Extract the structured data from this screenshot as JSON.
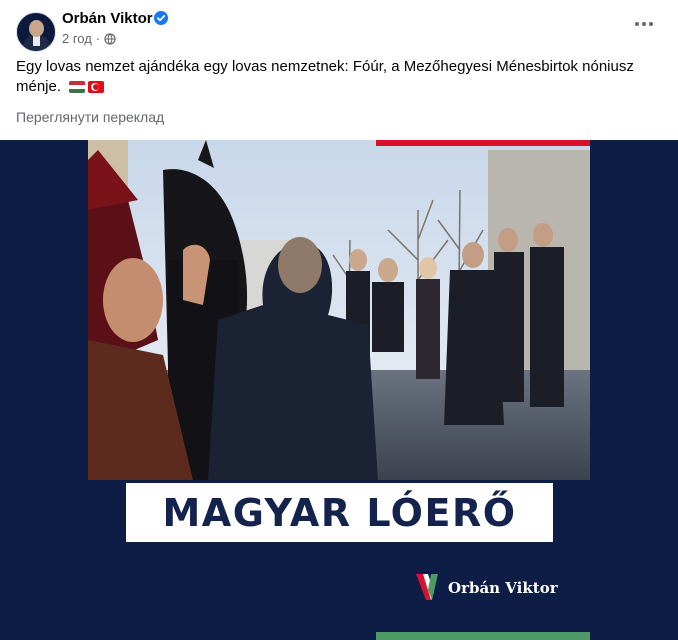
{
  "post": {
    "author_name": "Orbán Viktor",
    "time": "2 год",
    "text": "Egy lovas nemzet ajándéka egy lovas nemzetnek: Fóúr, a Mezőhegyesi Ménesbirtok nóniusz ménje.",
    "see_translation": "Переглянути переклад"
  },
  "image": {
    "headline": "MAGYAR LÓERŐ",
    "brand_name": "Orbán Viktor"
  },
  "icons": {
    "verified": "verified-badge-icon",
    "audience": "globe-icon",
    "more": "more-options-icon"
  },
  "colors": {
    "navy": "#0e1d46",
    "red": "#d8112a",
    "green": "#4e9a66",
    "verified_blue": "#1877f2"
  }
}
